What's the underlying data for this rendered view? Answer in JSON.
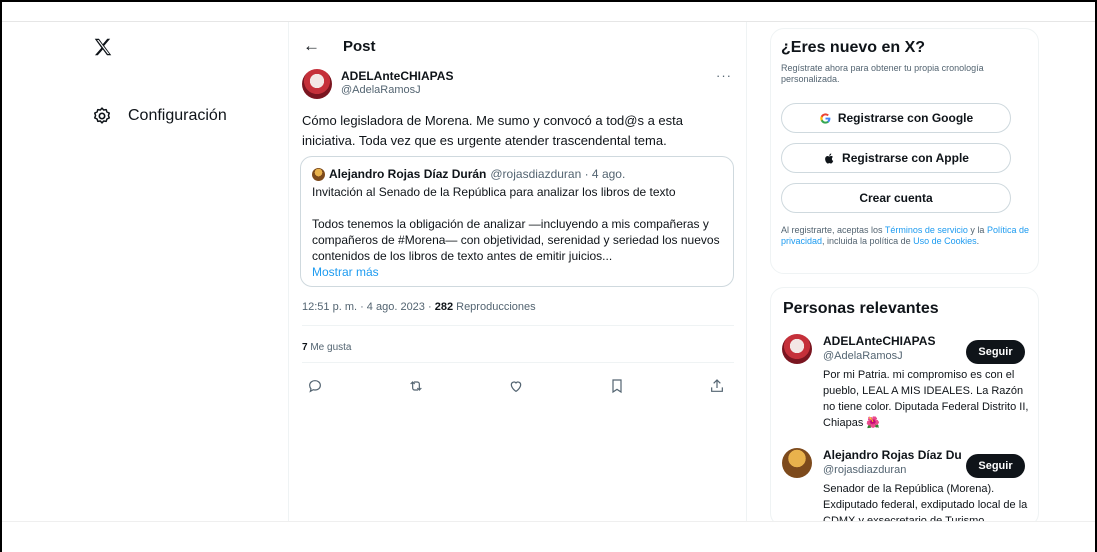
{
  "nav": {
    "logo_icon": "x-logo-icon",
    "settings_label": "Configuración",
    "settings_icon": "gear-icon"
  },
  "post": {
    "header_title": "Post",
    "author_name": "ADELAnteCHIAPAS",
    "author_handle": "@AdelaRamosJ",
    "more_label": "···",
    "text": "Cómo legisladora de Morena. Me sumo y convocó a tod@s a esta iniciativa. Toda vez que es urgente atender trascendental tema.",
    "quote": {
      "author_name": "Alejandro Rojas Díaz Durán",
      "meta": "@rojasdiazduran · 4 ago.",
      "subject": "Invitación al Senado de la República para analizar los libros de texto",
      "body": "Todos tenemos la obligación de analizar —incluyendo a mis compañeras y compañeros de #Morena— con objetividad, serenidad y seriedad los nuevos contenidos de los libros de texto antes de emitir juicios...",
      "show_more": "Mostrar más"
    },
    "timestamp": "12:51 p. m. · 4 ago. 2023 · ",
    "views_count": "282",
    "views_label": " Reproducciones",
    "likes_count": "7",
    "likes_label": " Me gusta"
  },
  "signup": {
    "title": "¿Eres nuevo en X?",
    "subtitle": "Regístrate ahora para obtener tu propia cronología personalizada.",
    "google_label": "Registrarse con Google",
    "apple_label": "Registrarse con Apple",
    "create_label": "Crear cuenta",
    "legal_1": "Al registrarte, aceptas los ",
    "terms_link": "Términos de servicio",
    "legal_2": " y la ",
    "privacy_link": "Política de privacidad",
    "legal_3": ", incluida la política de ",
    "cookies_link": "Uso de Cookies",
    "legal_4": "."
  },
  "relevant": {
    "title": "Personas relevantes",
    "people": [
      {
        "name": "ADELAnteCHIAPAS",
        "handle": "@AdelaRamosJ",
        "bio": "Por mi Patria. mi compromiso es con el pueblo, LEAL A MIS IDEALES. La Razón no tiene color. Diputada Federal Distrito II, Chiapas 🌺",
        "follow_label": "Seguir"
      },
      {
        "name": "Alejandro Rojas Díaz Du",
        "handle": "@rojasdiazduran",
        "bio": "Senador de la República (Morena). Exdiputado federal, exdiputado local de la CDMX y exsecretario de Turismo",
        "follow_label": "Seguir"
      }
    ]
  },
  "colors": {
    "accent": "#1d9bf0",
    "text": "#0f1419",
    "muted": "#536471",
    "border": "#eff3f4"
  }
}
